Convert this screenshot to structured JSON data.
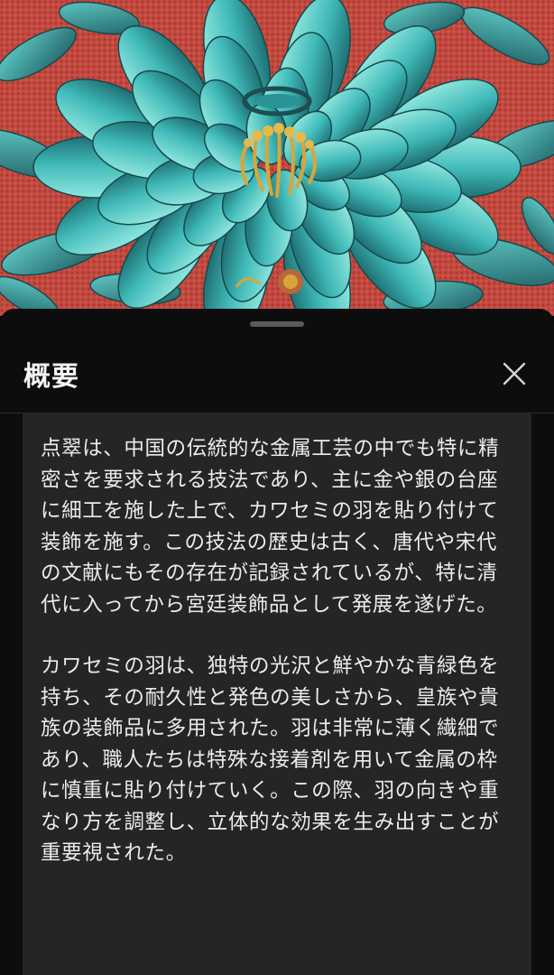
{
  "hero": {
    "image_description_icon": "kingfisher-feather-flower-image",
    "colors": {
      "background": "#c2493f",
      "petal": "#3fb9b8",
      "petal_light": "#7fdcd6",
      "petal_dark": "#1f6f73",
      "gold": "#d9a53a"
    }
  },
  "sheet": {
    "title": "概要",
    "close_icon": "close-icon",
    "paragraphs": [
      "点翠は、中国の伝統的な金属工芸の中でも特に精密さを要求される技法であり、主に金や銀の台座に細工を施した上で、カワセミの羽を貼り付けて装飾を施す。この技法の歴史は古く、唐代や宋代の文献にもその存在が記録されているが、特に清代に入ってから宮廷装飾品として発展を遂げた。",
      "カワセミの羽は、独特の光沢と鮮やかな青緑色を持ち、その耐久性と発色の美しさから、皇族や貴族の装飾品に多用された。羽は非常に薄く繊細であり、職人たちは特殊な接着剤を用いて金属の枠に慎重に貼り付けていく。この際、羽の向きや重なり方を調整し、立体的な効果を生み出すことが重要視された。"
    ]
  }
}
